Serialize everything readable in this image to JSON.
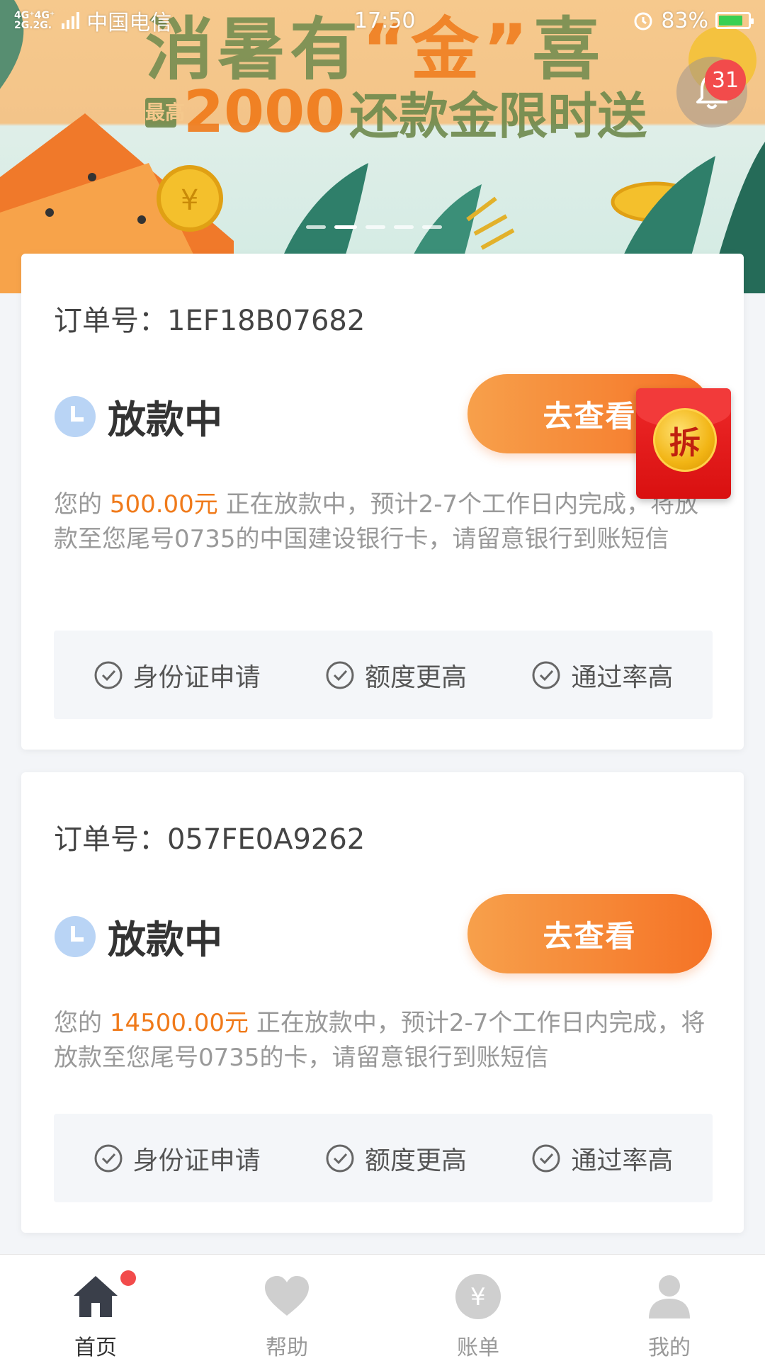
{
  "status_bar": {
    "network_top": "4G⁺4G⁺",
    "network_bottom": "2G.2G.",
    "carrier": "中国电信",
    "time": "17:50",
    "battery": "83%",
    "battery_level": 0.83
  },
  "banner": {
    "title_a": "消暑有",
    "title_gold": "“金”",
    "title_b": "喜",
    "tag": "最高",
    "amount": "2000",
    "sub": "还款金限时送",
    "slides": 5,
    "active_slide": 2
  },
  "notifications": {
    "count": "31"
  },
  "orders": [
    {
      "order_label": "订单号：1EF18B07682",
      "status": "放款中",
      "button": "去查看",
      "desc_prefix": "您的 ",
      "amount": "500.00元",
      "desc_suffix": " 正在放款中，预计2-7个工作日内完成，将放款至您尾号0735的中国建设银行卡，请留意银行到账短信",
      "features": [
        "身份证申请",
        "额度更高",
        "通过率高"
      ]
    },
    {
      "order_label": "订单号：057FE0A9262",
      "status": "放款中",
      "button": "去查看",
      "desc_prefix": "您的 ",
      "amount": "14500.00元",
      "desc_suffix": " 正在放款中，预计2-7个工作日内完成，将放款至您尾号0735的卡，请留意银行到账短信",
      "features": [
        "身份证申请",
        "额度更高",
        "通过率高"
      ]
    }
  ],
  "red_envelope": {
    "label": "拆"
  },
  "tabbar": [
    {
      "label": "首页",
      "icon": "home-icon",
      "active": true,
      "badge": true
    },
    {
      "label": "帮助",
      "icon": "heart-icon",
      "active": false
    },
    {
      "label": "账单",
      "icon": "yen-icon",
      "active": false
    },
    {
      "label": "我的",
      "icon": "person-icon",
      "active": false
    }
  ],
  "colors": {
    "accent": "#f57326",
    "amount": "#f07a1a",
    "badge": "#f24b4b"
  }
}
